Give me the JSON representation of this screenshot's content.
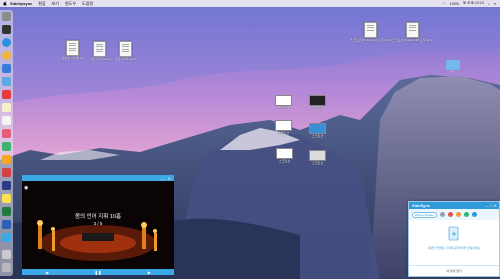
{
  "menubar": {
    "app_name": "Sidebysync",
    "menu_edit": "편집",
    "menu_view": "보기",
    "menu_window": "윈도우",
    "menu_help": "도움말",
    "battery": "100%",
    "clock": "토 오후 12:13"
  },
  "desktop": {
    "doc_icons": [
      {
        "label": "동영상 파일명.txt"
      },
      {
        "label": "가로 이미지.docx"
      },
      {
        "label": "세로 이미지.docx"
      }
    ],
    "top_right_icons": [
      {
        "label": "스크린샷 2019-02-16 오후 12.01"
      },
      {
        "label": "스크린샷 2019-02-16 오후 12.01"
      }
    ],
    "folder_label": "폴더",
    "screenshot_icons": [
      {
        "label": "스크린샷"
      },
      {
        "label": "스크린샷"
      },
      {
        "label": "스크린샷"
      },
      {
        "label": "스크린샷"
      },
      {
        "label": "스크린샷"
      },
      {
        "label": "스크린샷"
      }
    ]
  },
  "player": {
    "title": "몸의 언어 지휘 10홉",
    "counter": "3 / 5",
    "close_glyph": "✕",
    "min_glyph": "—"
  },
  "messenger": {
    "app_name": "SideSync",
    "chip_label": "Phone Screen",
    "message": "화면을 연결된 기기에 공유하려면 클릭하세요",
    "footer": "새 창에 열기"
  }
}
